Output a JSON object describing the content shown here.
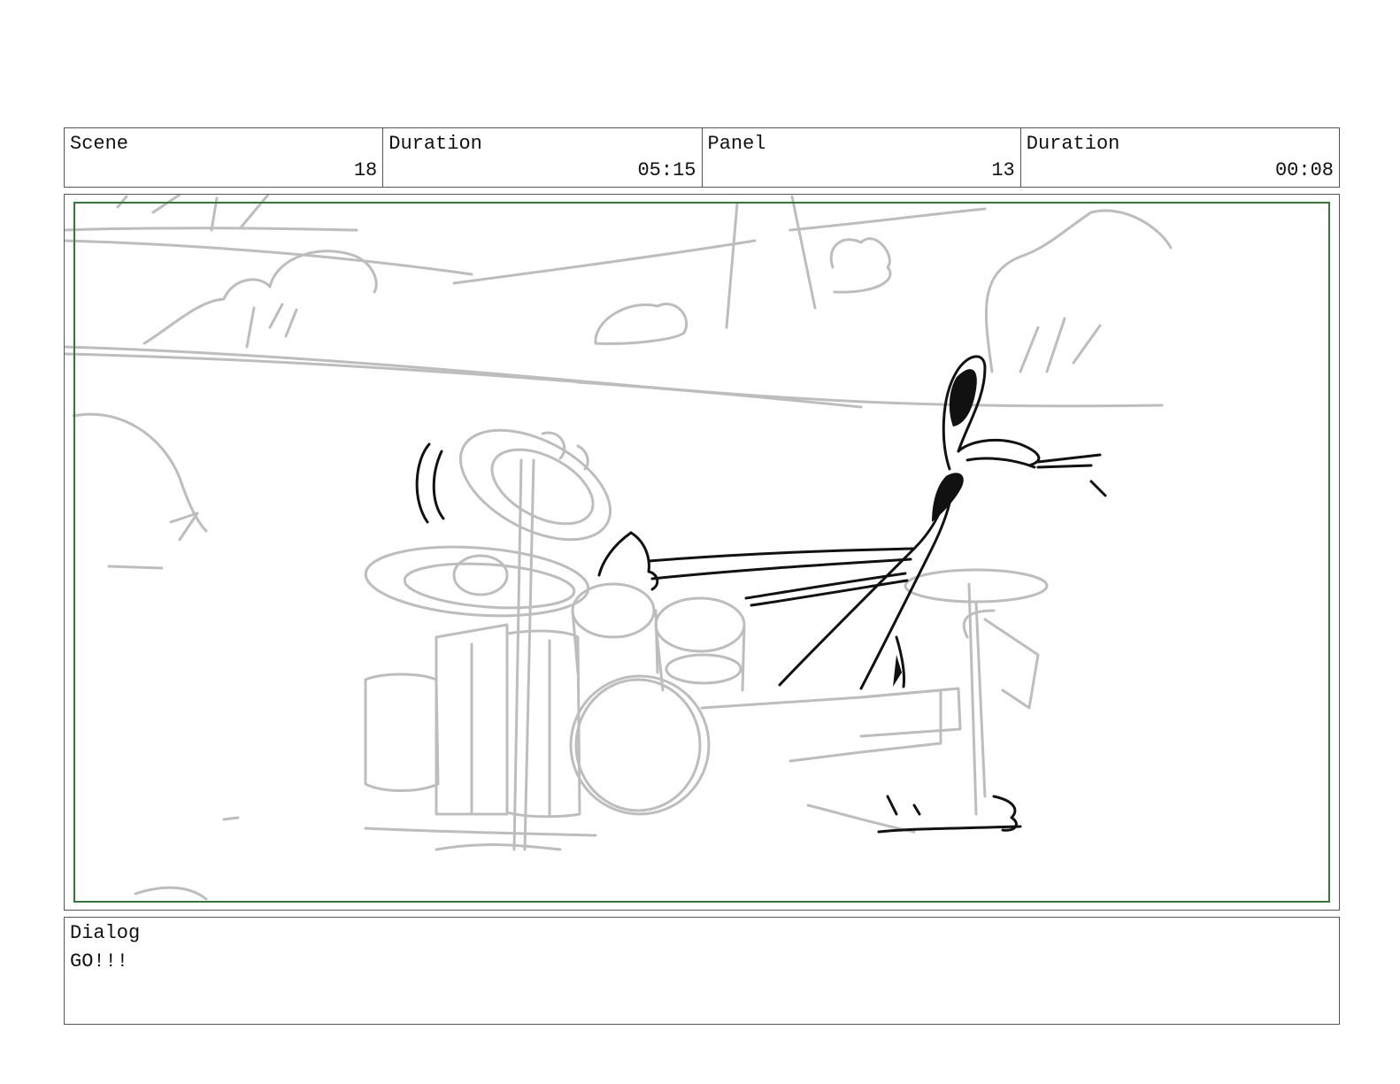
{
  "header": {
    "scene_label": "Scene",
    "scene_value": "18",
    "scene_duration_label": "Duration",
    "scene_duration_value": "05:15",
    "panel_label": "Panel",
    "panel_value": "13",
    "panel_duration_label": "Duration",
    "panel_duration_value": "00:08"
  },
  "dialog": {
    "label": "Dialog",
    "text": "GO!!!"
  },
  "colors": {
    "safe_area": "#2e7d32",
    "sketch_gray": "#b8b8b8",
    "sketch_ink": "#111111",
    "border": "#555555"
  }
}
